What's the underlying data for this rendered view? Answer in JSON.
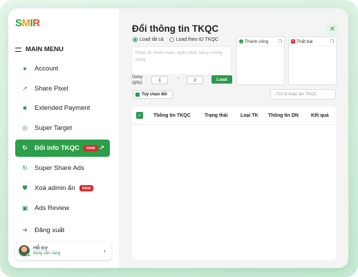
{
  "brand": {
    "logo_s": "S",
    "logo_m": "M",
    "logo_i": "I",
    "logo_r": "R"
  },
  "sidebar": {
    "menu_title": "MAIN MENU",
    "items": [
      {
        "label": "Account",
        "icon": "user-icon"
      },
      {
        "label": "Share Pixel",
        "icon": "share-icon"
      },
      {
        "label": "Extended Payment",
        "icon": "card-icon"
      },
      {
        "label": "Super Target",
        "icon": "target-icon"
      },
      {
        "label": "Đổi info TKQC",
        "icon": "refresh-icon",
        "badge": "new",
        "active": true
      },
      {
        "label": "Super Share Ads",
        "icon": "refresh-icon"
      },
      {
        "label": "Xoá admin ẩn",
        "icon": "shield-icon",
        "badge": "new"
      },
      {
        "label": "Ads Review",
        "icon": "screen-icon"
      },
      {
        "label": "Đăng xuất",
        "icon": "logout-icon"
      }
    ],
    "support": {
      "name": "Hỗ trợ",
      "status": "đang sẵn sàng"
    }
  },
  "main": {
    "title": "Đổi thông tin TKQC",
    "radio_all": "Load tất cả",
    "radio_by_id": "Load theo ID TKQC",
    "textarea_placeholder": "Nhập ID muốn load, ngăn cách bằng xuống dòng",
    "success_label": "Thành công",
    "failed_label": "Thất bại",
    "delay_label_1": "Delay",
    "delay_label_2": "(giây)",
    "delay_from": "1",
    "delay_to": "2",
    "dash": "-",
    "load_button": "Load",
    "custom_button": "Tuỳ chọn đổi",
    "search_placeholder": "Tìm id hoặc tên TKQC",
    "columns": [
      "Thông tin TKQC",
      "Trạng thái",
      "Loại TK",
      "Thông tin DN",
      "Kết quả"
    ]
  },
  "colors": {
    "accent": "#2d9f48",
    "badge": "#e1272b"
  }
}
